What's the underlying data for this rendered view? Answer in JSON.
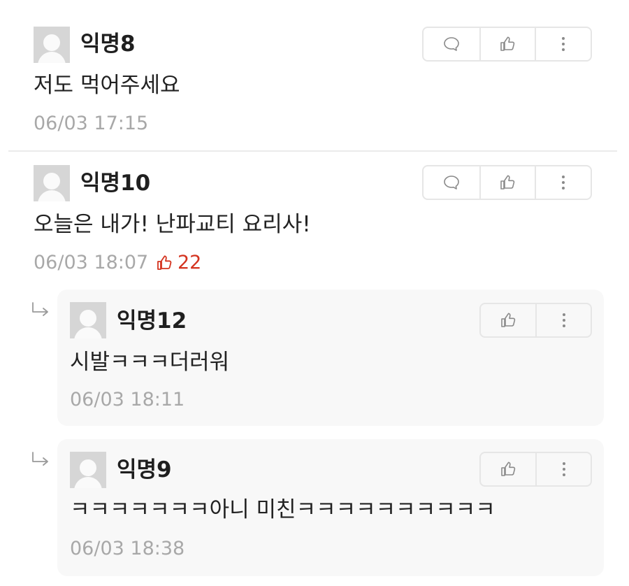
{
  "comments": [
    {
      "nick": "익명8",
      "text": "저도 먹어주세요",
      "time": "06/03 17:15"
    },
    {
      "nick": "익명10",
      "text": "오늘은 내가! 난파교티 요리사!",
      "time": "06/03 18:07",
      "votes": "22"
    }
  ],
  "replies": [
    {
      "nick": "익명12",
      "text": "시발ㅋㅋㅋ더러워",
      "time": "06/03 18:11"
    },
    {
      "nick": "익명9",
      "text": "ㅋㅋㅋㅋㅋㅋㅋ아니 미친ㅋㅋㅋㅋㅋㅋㅋㅋㅋㅋ",
      "time": "06/03 18:38"
    }
  ],
  "icons": {
    "reply": "speech-bubble-icon",
    "like": "thumbs-up-icon",
    "more": "more-vertical-icon",
    "reply_indicator": "reply-arrow-icon"
  },
  "colors": {
    "vote": "#d4331f",
    "muted": "#a8a8a8",
    "border": "#e6e6e6",
    "reply_bg": "#f8f8f8"
  }
}
